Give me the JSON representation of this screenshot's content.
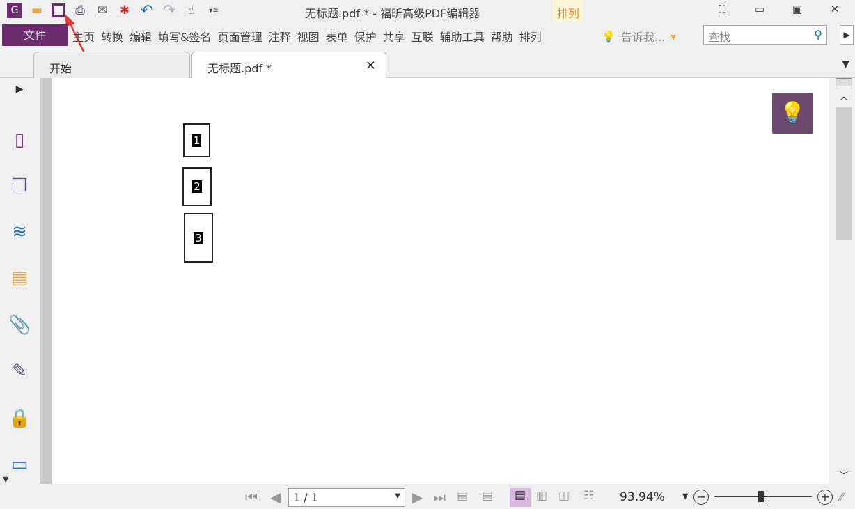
{
  "title": "无标题.pdf * - 福昕高级PDF编辑器",
  "context_tab": "排列",
  "file_button": "文件",
  "menu": [
    "主页",
    "转换",
    "编辑",
    "填写&签名",
    "页面管理",
    "注释",
    "视图",
    "表单",
    "保护",
    "共享",
    "互联",
    "辅助工具",
    "帮助",
    "排列"
  ],
  "tell_me": "告诉我...",
  "search_placeholder": "查找",
  "tabs": [
    {
      "label": "开始"
    },
    {
      "label": "无标题.pdf *"
    }
  ],
  "doc_boxes": [
    "1",
    "2",
    "3"
  ],
  "page_nav": "1 / 1",
  "zoom_level": "93.94%",
  "zoom_slider_fraction": 0.45,
  "accent": "#6b2c6e"
}
